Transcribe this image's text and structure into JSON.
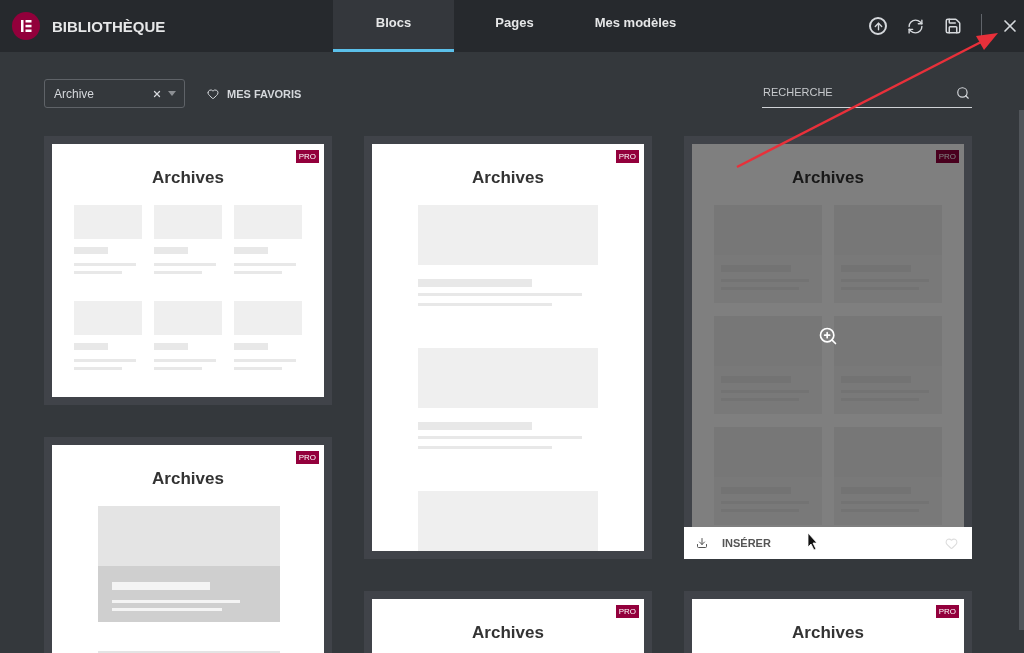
{
  "header": {
    "title": "BIBLIOTHÈQUE",
    "tabs": [
      {
        "label": "Blocs",
        "selected": true
      },
      {
        "label": "Pages",
        "selected": false
      },
      {
        "label": "Mes modèles",
        "selected": false
      }
    ]
  },
  "toolbar": {
    "category": {
      "value": "Archive"
    },
    "favorites": "MES FAVORIS",
    "search": {
      "placeholder": "RECHERCHE"
    }
  },
  "columns": [
    [
      {
        "kind": "grid3",
        "title": "Archives",
        "badge": "PRO",
        "hovered": false
      },
      {
        "kind": "hero",
        "title": "Archives",
        "badge": "PRO",
        "hovered": false
      }
    ],
    [
      {
        "kind": "list",
        "title": "Archives",
        "badge": "PRO",
        "hovered": false
      },
      {
        "kind": "list",
        "title": "Archives",
        "badge": "PRO",
        "hovered": false
      }
    ],
    [
      {
        "kind": "grid2",
        "title": "Archives",
        "badge": "PRO",
        "hovered": true,
        "insert_label": "INSÉRER"
      },
      {
        "kind": "grid2",
        "title": "Archives",
        "badge": "PRO",
        "hovered": false
      }
    ]
  ]
}
